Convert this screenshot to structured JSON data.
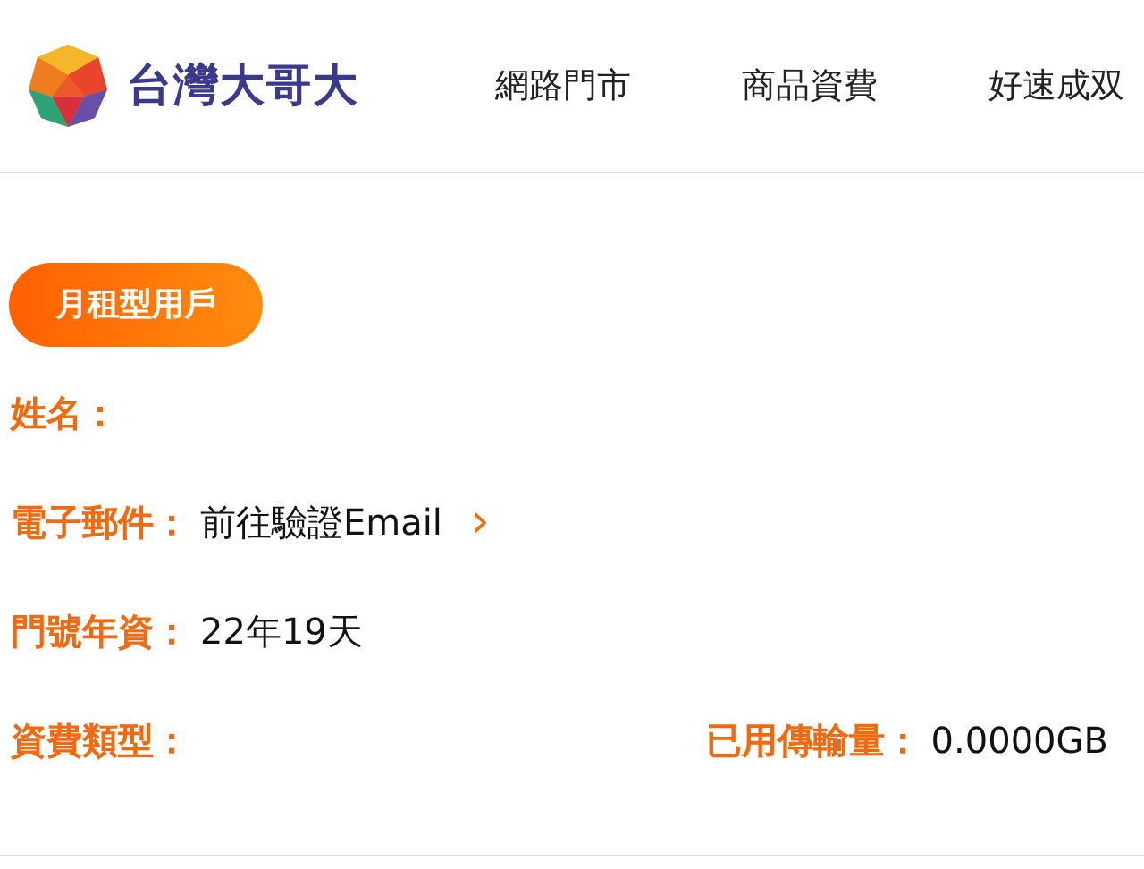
{
  "header": {
    "logo_text": "台灣大哥大",
    "nav": [
      "網路門市",
      "商品資費",
      "好速成双"
    ]
  },
  "badge": "月租型用戶",
  "rows": [
    {
      "items": [
        {
          "label": "姓名："
        }
      ]
    },
    {
      "items": [
        {
          "label": "電子郵件：",
          "value": "前往驗證Email",
          "kind": "link",
          "chevron": "›"
        }
      ]
    },
    {
      "items": [
        {
          "label": "門號年資：",
          "value": "22年19天"
        }
      ]
    },
    {
      "items": [
        {
          "label": "資費類型："
        },
        {
          "label": "已用傳輸量：",
          "value": "0.0000GB"
        }
      ]
    }
  ]
}
